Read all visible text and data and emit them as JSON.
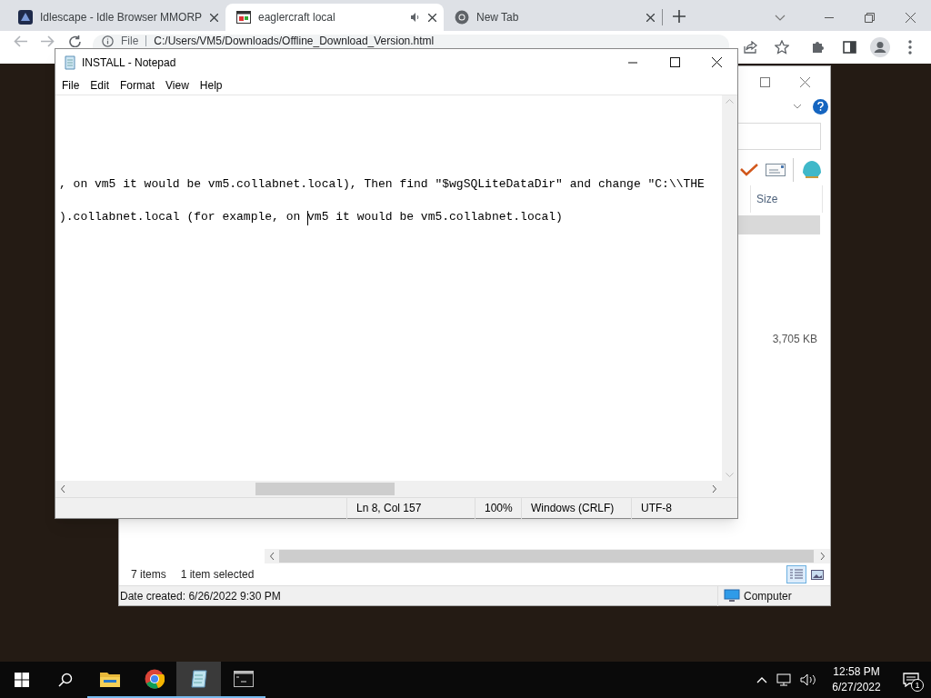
{
  "browser": {
    "tabs": [
      {
        "title": "Idlescape - Idle Browser MMORP",
        "selected": false,
        "audio": false,
        "kind": "game"
      },
      {
        "title": "eaglercraft local",
        "selected": true,
        "audio": true,
        "kind": "page"
      },
      {
        "title": "New Tab",
        "selected": false,
        "audio": false,
        "kind": "chrome"
      }
    ],
    "address": {
      "scheme": "File",
      "url": "C:/Users/VM5/Downloads/Offline_Download_Version.html"
    }
  },
  "explorer": {
    "column": "Size",
    "size": "3,705 KB",
    "item_count": "7 items",
    "selection": "1 item selected",
    "details": "Date created: 6/26/2022 9:30 PM",
    "location": "Computer"
  },
  "notepad": {
    "title": "INSTALL - Notepad",
    "menu": [
      "File",
      "Edit",
      "Format",
      "View",
      "Help"
    ],
    "lines": [
      ", on vm5 it would be vm5.collabnet.local), Then find \"$wgSQLiteDataDir\" and change \"C:\\\\THE",
      ").collabnet.local (for example, on vm5 it would be vm5.collabnet.local)"
    ],
    "status": [
      "Ln 8, Col 157",
      "100%",
      "Windows (CRLF)",
      "UTF-8"
    ]
  },
  "taskbar": {
    "apps": [
      {
        "kind": "folder",
        "selected": false
      },
      {
        "kind": "chrome",
        "selected": false
      },
      {
        "kind": "notepad",
        "selected": true
      },
      {
        "kind": "terminal",
        "selected": false
      }
    ],
    "time": "12:58 PM",
    "date": "6/27/2022",
    "notifications": "1"
  }
}
